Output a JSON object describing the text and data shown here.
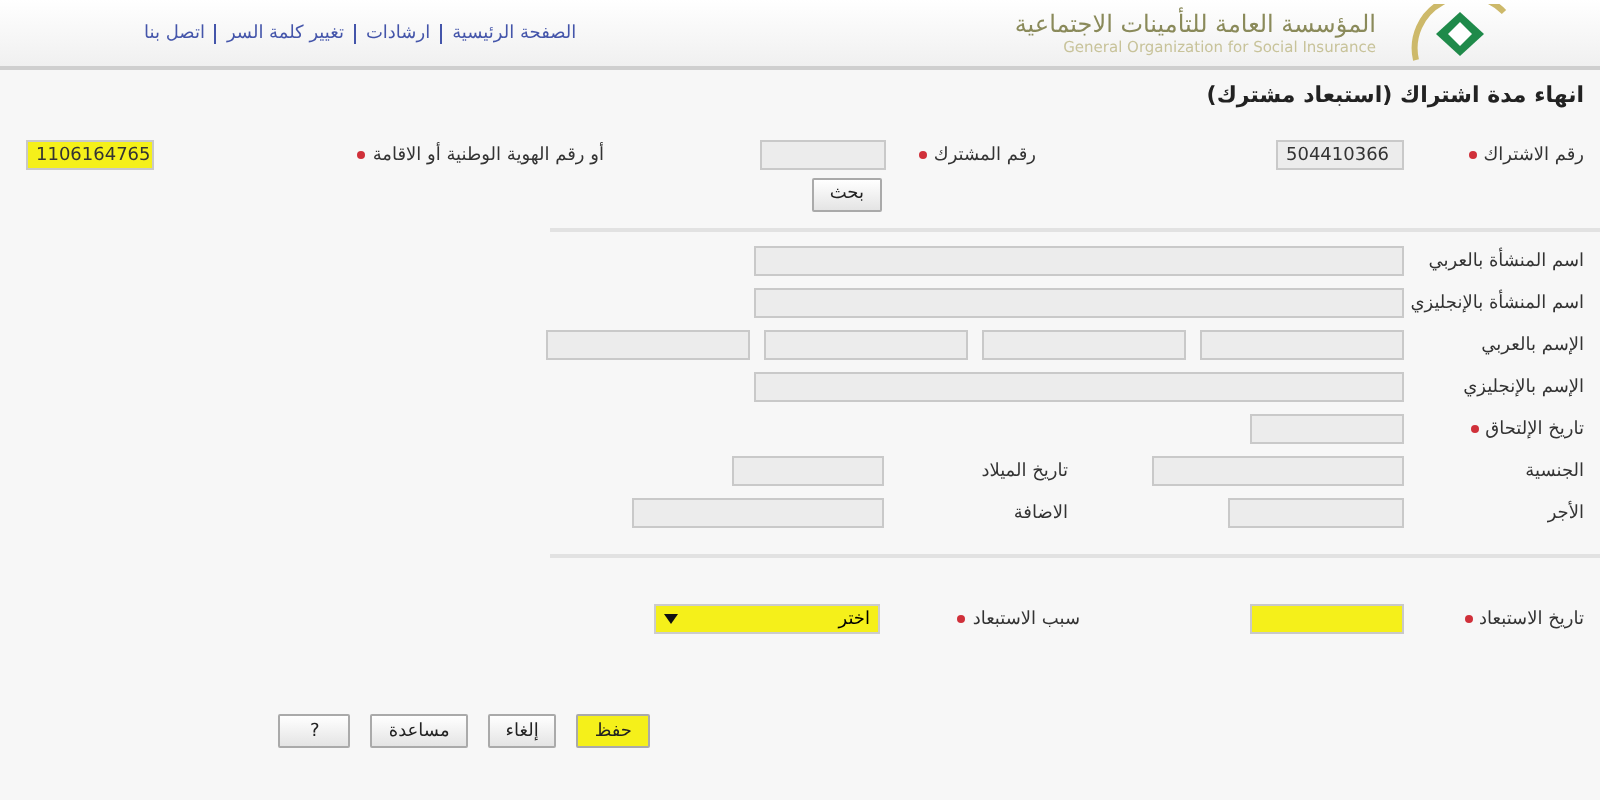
{
  "header": {
    "org_name_ar": "المؤسسة العامة للتأمينات الاجتماعية",
    "org_name_en": "General Organization for Social Insurance",
    "links": [
      "الصفحة الرئيسية",
      "ارشادات",
      "تغيير كلمة السر",
      "اتصل بنا"
    ]
  },
  "title": "انهاء مدة اشتراك (استبعاد مشترك)",
  "lookup": [
    {
      "label": "رقم الاشتراك",
      "required": true,
      "value": "504410366",
      "highlighted": false
    },
    {
      "label": "رقم المشترك",
      "required": true,
      "highlighted": false
    },
    {
      "label": "أو رقم الهوية الوطنية أو الاقامة",
      "required": true,
      "value": "1106164765",
      "highlighted": true
    }
  ],
  "search_button": "بحث",
  "details": [
    {
      "kind": "wide",
      "label": "اسم المنشأة بالعربي"
    },
    {
      "kind": "wide",
      "label": "اسم المنشأة بالإنجليزي"
    },
    {
      "kind": "quad",
      "label": "الإسم بالعربي"
    },
    {
      "kind": "wide",
      "label": "الإسم بالإنجليزي"
    },
    {
      "kind": "short",
      "label": "تاريخ الإلتحاق",
      "required": true
    },
    {
      "kind": "pair",
      "label": "الجنسية",
      "second_label": "تاريخ الميلاد"
    },
    {
      "kind": "pair",
      "label": "الأجر",
      "second_label": "الاضافة"
    }
  ],
  "exclusion": {
    "date_label": "تاريخ الاستبعاد",
    "date_highlighted": true,
    "reason_label": "سبب الاستبعاد",
    "reason_value": "اختر",
    "reason_highlighted": true
  },
  "buttons": [
    {
      "label": "حفظ",
      "highlighted": true
    },
    {
      "label": "إلغاء",
      "highlighted": false
    },
    {
      "label": "مساعدة",
      "highlighted": false
    },
    {
      "label": "?",
      "highlighted": false
    }
  ]
}
